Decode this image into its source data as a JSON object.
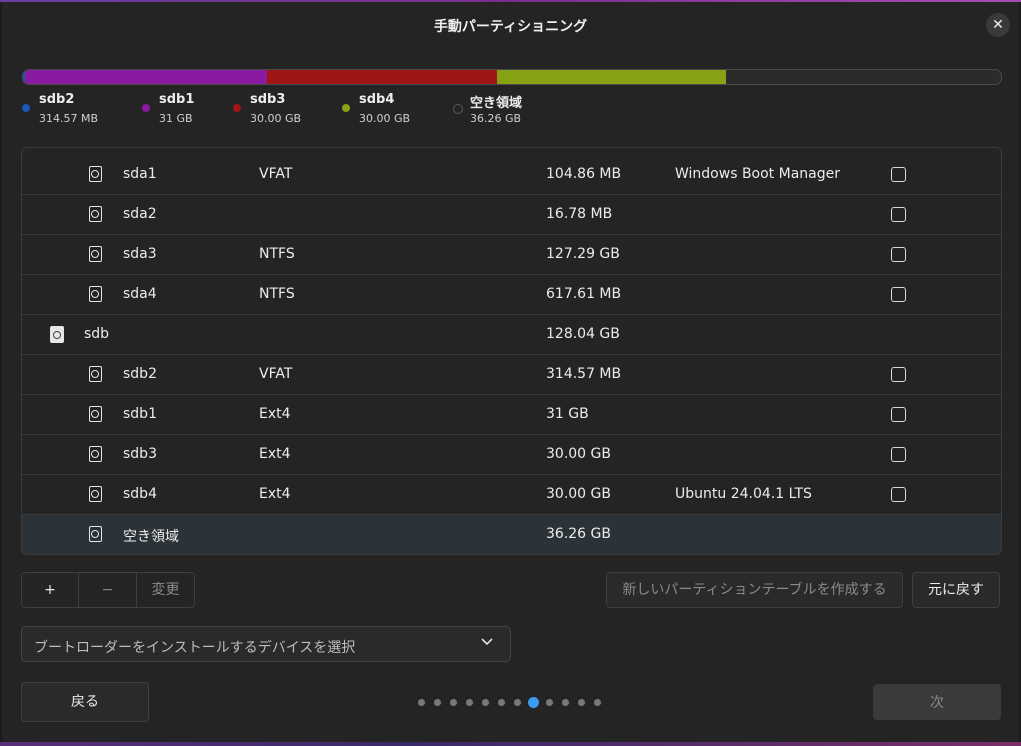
{
  "window": {
    "title": "手動パーティショニング"
  },
  "partition_bar": {
    "segments": [
      {
        "name": "sdb2",
        "fraction": 0.0025,
        "color": "#1a57b8"
      },
      {
        "name": "sdb1",
        "fraction": 0.2472,
        "color": "#8a1aa0"
      },
      {
        "name": "sdb3",
        "fraction": 0.235,
        "color": "#a01515"
      },
      {
        "name": "sdb4",
        "fraction": 0.234,
        "color": "#86a214"
      }
    ],
    "free_color": "#2b2b2b"
  },
  "legend": [
    {
      "name": "sdb2",
      "size": "314.57 MB",
      "color": "#1a57b8"
    },
    {
      "name": "sdb1",
      "size": "31 GB",
      "color": "#8a1aa0"
    },
    {
      "name": "sdb3",
      "size": "30.00 GB",
      "color": "#a01515"
    },
    {
      "name": "sdb4",
      "size": "30.00 GB",
      "color": "#86a214"
    },
    {
      "name": "空き領域",
      "size": "36.26 GB",
      "color": "#242424"
    }
  ],
  "partitions": [
    {
      "device": "sda1",
      "fs": "VFAT",
      "size": "104.86 MB",
      "system": "Windows Boot Manager",
      "checkbox": true,
      "level": 1
    },
    {
      "device": "sda2",
      "fs": "",
      "size": "16.78 MB",
      "system": "",
      "checkbox": true,
      "level": 1
    },
    {
      "device": "sda3",
      "fs": "NTFS",
      "size": "127.29 GB",
      "system": "",
      "checkbox": true,
      "level": 1
    },
    {
      "device": "sda4",
      "fs": "NTFS",
      "size": "617.61 MB",
      "system": "",
      "checkbox": true,
      "level": 1
    },
    {
      "device": "sdb",
      "fs": "",
      "size": "128.04 GB",
      "system": "",
      "checkbox": false,
      "level": 0
    },
    {
      "device": "sdb2",
      "fs": "VFAT",
      "size": "314.57 MB",
      "system": "",
      "checkbox": true,
      "level": 1
    },
    {
      "device": "sdb1",
      "fs": "Ext4",
      "size": "31 GB",
      "system": "",
      "checkbox": true,
      "level": 1
    },
    {
      "device": "sdb3",
      "fs": "Ext4",
      "size": "30.00 GB",
      "system": "",
      "checkbox": true,
      "level": 1
    },
    {
      "device": "sdb4",
      "fs": "Ext4",
      "size": "30.00 GB",
      "system": "Ubuntu 24.04.1 LTS",
      "checkbox": true,
      "level": 1
    },
    {
      "device": "空き領域",
      "fs": "",
      "size": "36.26 GB",
      "system": "",
      "checkbox": false,
      "level": 1,
      "selected": true
    }
  ],
  "toolbar": {
    "add_label": "+",
    "remove_label": "−",
    "change_label": "変更",
    "new_table_label": "新しいパーティションテーブルを作成する",
    "revert_label": "元に戻す"
  },
  "bootloader": {
    "placeholder": "ブートローダーをインストールするデバイスを選択",
    "icon": "chevron-down-icon"
  },
  "footer": {
    "back_label": "戻る",
    "next_label": "次",
    "page_count": 12,
    "current_page": 8
  }
}
